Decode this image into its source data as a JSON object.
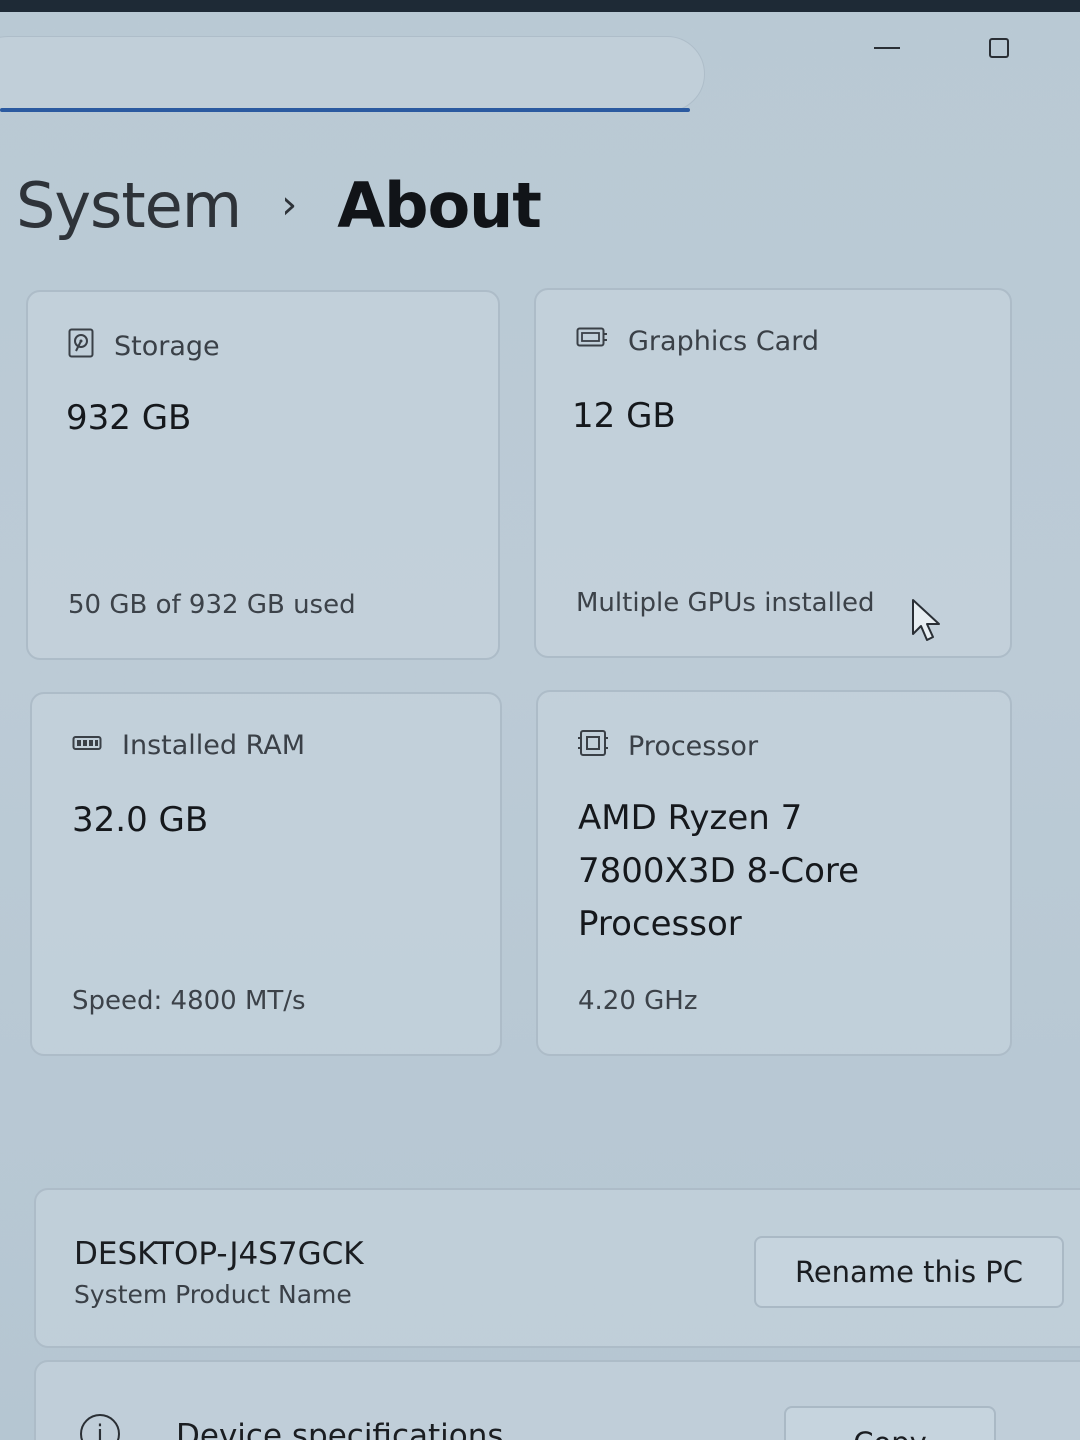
{
  "window": {
    "minimize_glyph": "minimize-icon",
    "maximize_glyph": "maximize-icon"
  },
  "breadcrumb": {
    "parent": "System",
    "separator": "›",
    "current": "About"
  },
  "specs": {
    "storage": {
      "icon": "hard-drive-icon",
      "label": "Storage",
      "value": "932 GB",
      "sub": "50 GB of 932 GB used"
    },
    "graphics": {
      "icon": "graphics-card-icon",
      "label": "Graphics Card",
      "value": "12 GB",
      "sub": "Multiple GPUs installed"
    },
    "ram": {
      "icon": "memory-icon",
      "label": "Installed RAM",
      "value": "32.0 GB",
      "sub": "Speed: 4800 MT/s"
    },
    "processor": {
      "icon": "processor-icon",
      "label": "Processor",
      "value_lines": [
        "AMD Ryzen 7",
        "7800X3D 8-Core",
        "Processor"
      ],
      "sub": "4.20 GHz"
    }
  },
  "pc": {
    "name": "DESKTOP-J4S7GCK",
    "model": "System Product Name",
    "rename_label": "Rename this PC"
  },
  "device_specs": {
    "title": "Device specifications",
    "copy_label": "Copy",
    "icon": "info-icon"
  },
  "colors": {
    "accent": "#2b5aa0",
    "background": "#bccbd6"
  }
}
